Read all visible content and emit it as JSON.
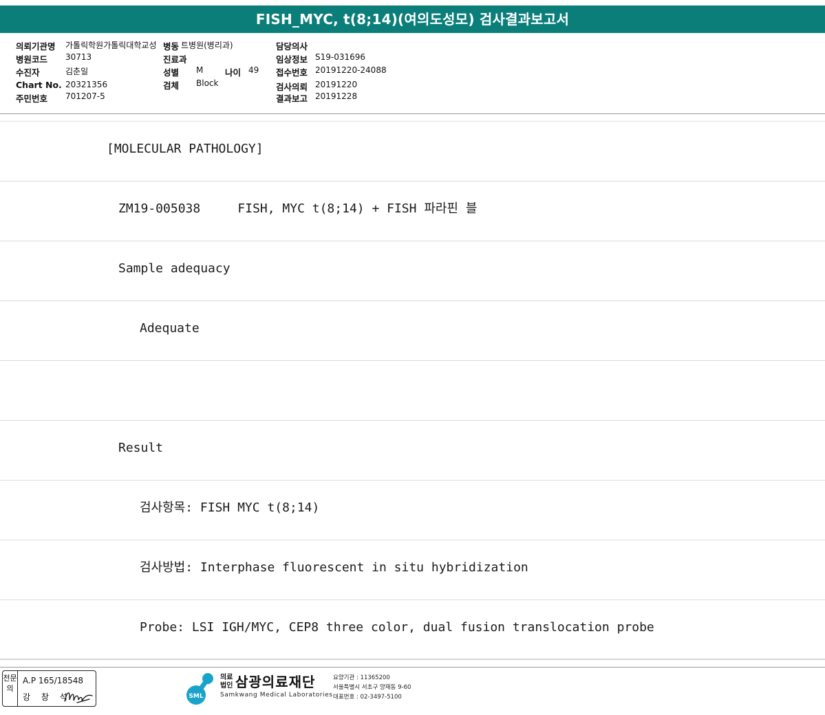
{
  "title": "FISH_MYC, t(8;14)(여의도성모) 검사결과보고서",
  "header": {
    "institution_label": "의뢰기관명",
    "institution_value": "가톨릭학원가톨릭대학교성",
    "ward_label": "병동",
    "ward_value": "트병원(병리과)",
    "doctor_label": "담당의사",
    "doctor_value": "",
    "hospital_code_label": "병원코드",
    "hospital_code_value": "30713",
    "department_label": "진료과",
    "department_value": "",
    "clinical_info_label": "임상정보",
    "clinical_info_value": "S19-031696",
    "patient_label": "수진자",
    "patient_value": "김춘일",
    "sex_label": "성별",
    "sex_value": "M",
    "age_label": "나이",
    "age_value": "49",
    "receipt_no_label": "접수번호",
    "receipt_no_value": "20191220-24088",
    "chart_no_label": "Chart No.",
    "chart_no_value": "20321356",
    "specimen_label": "검체",
    "specimen_value": "Block",
    "request_date_label": "검사의뢰",
    "request_date_value": "20191220",
    "resident_no_label": "주민번호",
    "resident_no_value": "701207-5",
    "report_date_label": "결과보고",
    "report_date_value": "20191228"
  },
  "report_rows": [
    "[MOLECULAR PATHOLOGY]",
    "ZM19-005038     FISH, MYC t(8;14) + FISH 파라핀 블",
    "Sample adequacy",
    "Adequate",
    "",
    "Result",
    "검사항목: FISH MYC t(8;14)",
    "검사방법: Interphase fluorescent in situ hybridization",
    "Probe: LSI IGH/MYC, CEP8 three color, dual fusion translocation probe"
  ],
  "footer": {
    "stamp_vertical_label": "전문의",
    "stamp_license": "A.P 165/18548",
    "stamp_name": "강 창 석",
    "org_prefix": "의료법인",
    "org_name": "삼광의료재단",
    "org_english": "Samkwang Medical Laboratories",
    "logo_text": "SML",
    "org_code": "요양기관 : 11365200",
    "org_address": "서울특별시 서초구 양재동 9-60",
    "org_phone": "대표번호 : 02-3497-5100"
  },
  "colors": {
    "title_bar": "#0b7e7a"
  }
}
